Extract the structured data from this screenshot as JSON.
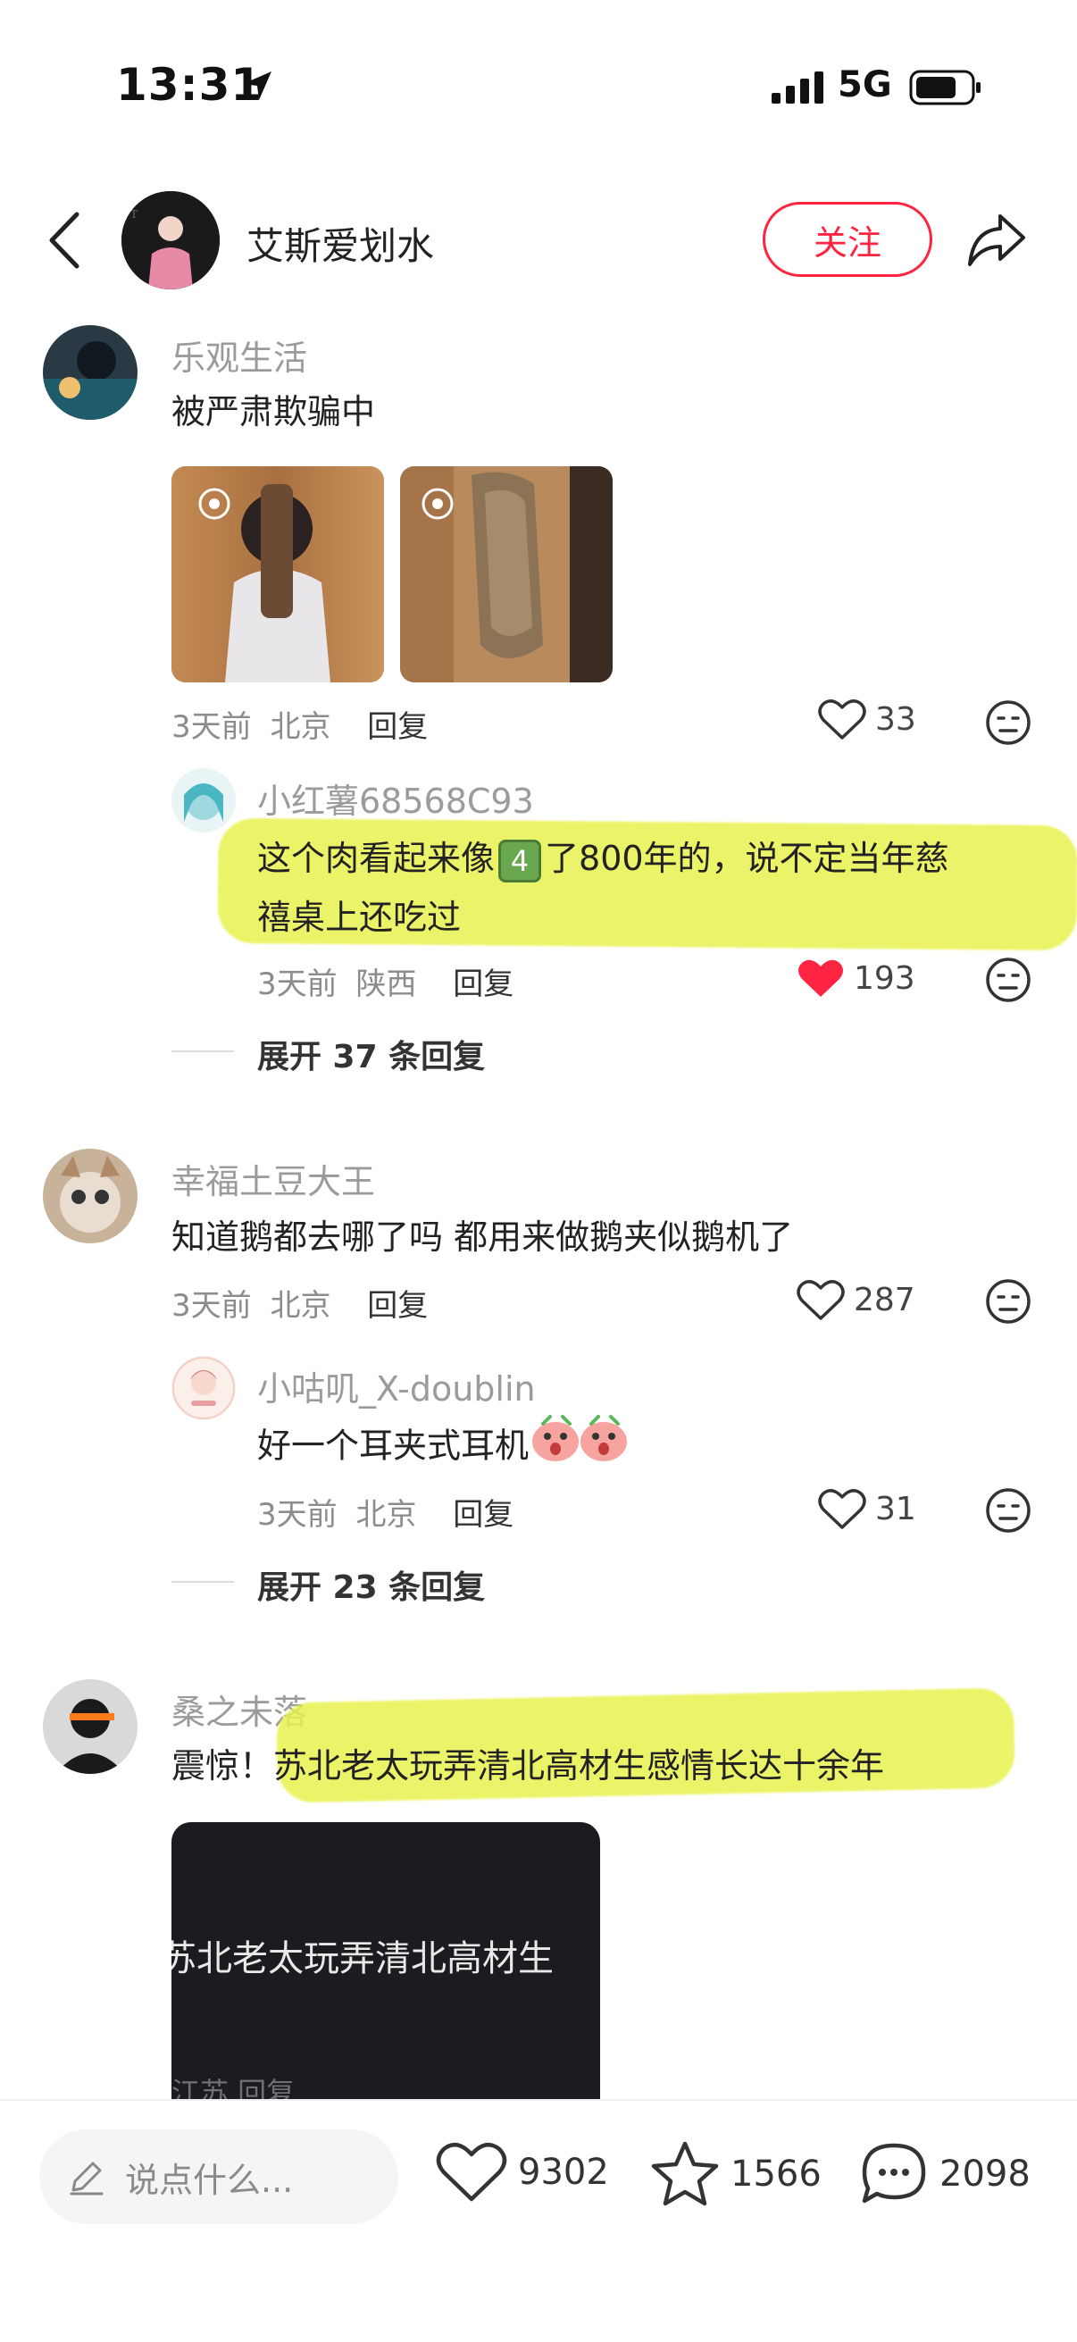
{
  "status_bar": {
    "time": "13:31",
    "network": "5G"
  },
  "header": {
    "author_name": "艾斯爱划水",
    "follow_label": "关注"
  },
  "comments": [
    {
      "user": "乐观生活",
      "text": "被严肃欺骗中",
      "time": "3天前",
      "location": "北京",
      "reply_label": "回复",
      "likes": "33",
      "replies": [
        {
          "user": "小红薯68568C93",
          "text_line1_a": "这个肉看起来像",
          "text_badge": "4",
          "text_line1_b": "了800年的，说不定当年慈",
          "text_line2": "禧桌上还吃过",
          "time": "3天前",
          "location": "陕西",
          "reply_label": "回复",
          "likes": "193"
        }
      ],
      "expand_label": "展开 37 条回复"
    },
    {
      "user": "幸福土豆大王",
      "text": "知道鹅都去哪了吗 都用来做鹅夹似鹅机了",
      "time": "3天前",
      "location": "北京",
      "reply_label": "回复",
      "likes": "287",
      "replies": [
        {
          "user": "小咕叽_X-doublin",
          "text": "好一个耳夹式耳机",
          "time": "3天前",
          "location": "北京",
          "reply_label": "回复",
          "likes": "31"
        }
      ],
      "expand_label": "展开 23 条回复"
    },
    {
      "user": "桑之未落",
      "text_prefix": "震惊！",
      "text_main": "苏北老太玩弄清北高材生感情长达十余年",
      "card_text": "苏北老太玩弄清北高材生",
      "card_sub": "江苏 回复"
    }
  ],
  "bottom_bar": {
    "input_placeholder": "说点什么...",
    "likes": "9302",
    "stars": "1566",
    "comments": "2098"
  },
  "colors": {
    "accent": "#ff2442",
    "highlight": "#e8f24f",
    "like_red": "#ff2442"
  }
}
